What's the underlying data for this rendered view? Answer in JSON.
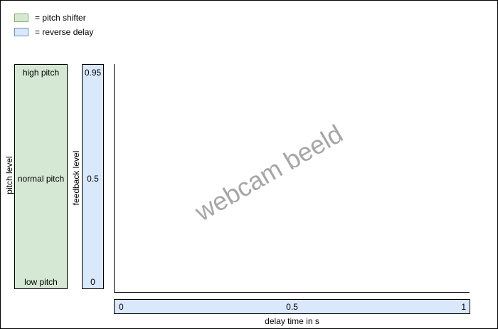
{
  "legend": {
    "items": [
      {
        "label": "= pitch shifter",
        "color": "#d5e8d4"
      },
      {
        "label": "= reverse delay",
        "color": "#dae8fc"
      }
    ]
  },
  "pitch_bar": {
    "axis_label": "pitch level",
    "top": "high pitch",
    "middle": "normal pitch",
    "bottom": "low pitch"
  },
  "feedback_bar": {
    "axis_label": "feedback level",
    "top": "0.95",
    "middle": "0.5",
    "bottom": "0"
  },
  "delay_bar": {
    "axis_label": "delay time in s",
    "left": "0",
    "middle": "0.5",
    "right": "1"
  },
  "webcam": {
    "watermark": "webcam beeld"
  },
  "colors": {
    "pitch_fill": "#d5e8d4",
    "pitch_border": "#82b366",
    "delay_fill": "#dae8fc",
    "delay_border": "#6c8ebf",
    "watermark": "#a6a6a6"
  }
}
